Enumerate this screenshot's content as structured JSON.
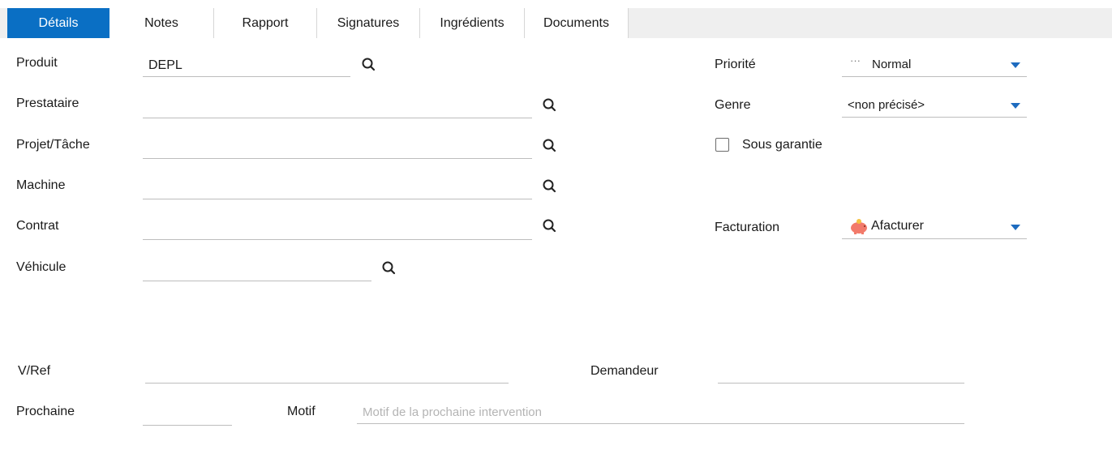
{
  "tabs": [
    {
      "label": "Détails",
      "active": true
    },
    {
      "label": "Notes",
      "active": false
    },
    {
      "label": "Rapport",
      "active": false
    },
    {
      "label": "Signatures",
      "active": false
    },
    {
      "label": "Ingrédients",
      "active": false
    },
    {
      "label": "Documents",
      "active": false
    }
  ],
  "fields": {
    "produit": {
      "label": "Produit",
      "value": "DEPL"
    },
    "prestataire": {
      "label": "Prestataire",
      "value": ""
    },
    "projet": {
      "label": "Projet/Tâche",
      "value": ""
    },
    "machine": {
      "label": "Machine",
      "value": ""
    },
    "contrat": {
      "label": "Contrat",
      "value": ""
    },
    "vehicule": {
      "label": "Véhicule",
      "value": ""
    },
    "vref": {
      "label": "V/Ref",
      "value": ""
    },
    "demandeur": {
      "label": "Demandeur",
      "value": ""
    },
    "prochaine": {
      "label": "Prochaine",
      "value": ""
    },
    "motif": {
      "label": "Motif",
      "value": "",
      "placeholder": "Motif de la prochaine intervention"
    }
  },
  "right": {
    "priorite": {
      "label": "Priorité",
      "value": "Normal",
      "icon": "dots-icon"
    },
    "genre": {
      "label": "Genre",
      "value": "<non précisé>"
    },
    "garantie": {
      "label": "Sous garantie",
      "checked": false
    },
    "facturation": {
      "label": "Facturation",
      "value": "Afacturer",
      "icon": "piggy-bank-icon"
    }
  },
  "colors": {
    "accent": "#0a6fc4",
    "arrow": "#1d6bbf",
    "pig": "#f27a6a"
  }
}
